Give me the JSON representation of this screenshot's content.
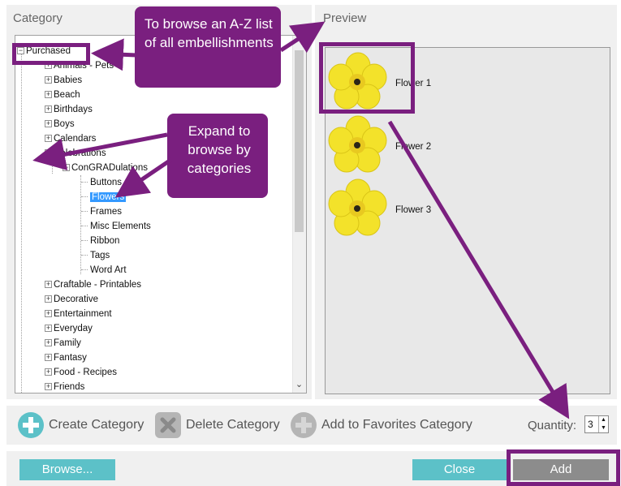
{
  "category_panel": {
    "title": "Category",
    "tree": [
      {
        "label": "Purchased",
        "toggle": "−"
      },
      {
        "label": "Animals - Pets",
        "toggle": "+"
      },
      {
        "label": "Babies",
        "toggle": "+"
      },
      {
        "label": "Beach",
        "toggle": "+"
      },
      {
        "label": "Birthdays",
        "toggle": "+"
      },
      {
        "label": "Boys",
        "toggle": "+"
      },
      {
        "label": "Calendars",
        "toggle": "+"
      },
      {
        "label": "Celebrations",
        "toggle": "−"
      },
      {
        "label": "ConGRADulations",
        "toggle": "−"
      },
      {
        "label": "Buttons"
      },
      {
        "label": "Flowers"
      },
      {
        "label": "Frames"
      },
      {
        "label": "Misc Elements"
      },
      {
        "label": "Ribbon"
      },
      {
        "label": "Tags"
      },
      {
        "label": "Word Art"
      },
      {
        "label": "Craftable - Printables",
        "toggle": "+"
      },
      {
        "label": "Decorative",
        "toggle": "+"
      },
      {
        "label": "Entertainment",
        "toggle": "+"
      },
      {
        "label": "Everyday",
        "toggle": "+"
      },
      {
        "label": "Family",
        "toggle": "+"
      },
      {
        "label": "Fantasy",
        "toggle": "+"
      },
      {
        "label": "Food - Recipes",
        "toggle": "+"
      },
      {
        "label": "Friends",
        "toggle": "+"
      }
    ]
  },
  "preview_panel": {
    "title": "Preview",
    "items": [
      {
        "label": "Flower 1"
      },
      {
        "label": "Flower 2"
      },
      {
        "label": "Flower 3"
      }
    ]
  },
  "toolbar": {
    "create_label": "Create Category",
    "delete_label": "Delete Category",
    "favorites_label": "Add to Favorites Category",
    "quantity_label": "Quantity:",
    "quantity_value": "3"
  },
  "actions": {
    "browse_label": "Browse...",
    "close_label": "Close",
    "add_label": "Add"
  },
  "callouts": {
    "browse_az": "To browse an A-Z list of all embellishments",
    "expand": "Expand to browse by categories"
  },
  "colors": {
    "accent_purple": "#7a1f7f",
    "teal_button": "#5cc1c8",
    "disabled_button": "#8c8c8c",
    "selection_blue": "#3399ff",
    "flower_yellow": "#f3e22a"
  }
}
